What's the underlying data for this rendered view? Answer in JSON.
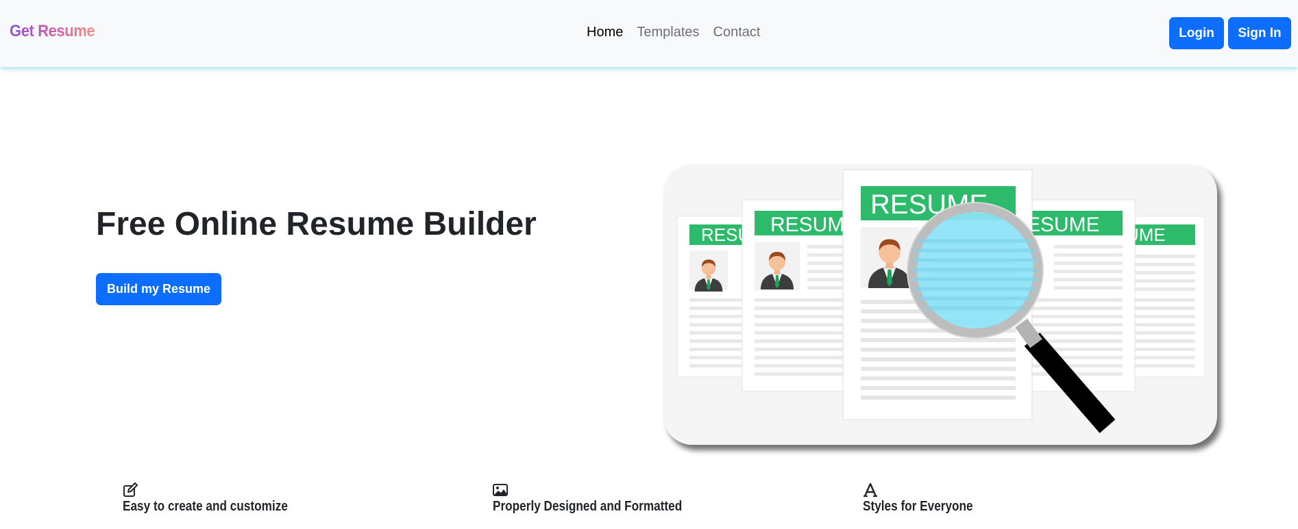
{
  "brand": {
    "name": "Get Resume"
  },
  "nav": {
    "links": [
      {
        "label": "Home",
        "active": true
      },
      {
        "label": "Templates",
        "active": false
      },
      {
        "label": "Contact",
        "active": false
      }
    ]
  },
  "auth": {
    "login_label": "Login",
    "signin_label": "Sign In"
  },
  "hero": {
    "title": "Free Online Resume Builder",
    "cta_label": "Build my Resume",
    "image": {
      "resume_header_text": "RESUME"
    }
  },
  "features": [
    {
      "icon": "pencil-square-icon",
      "title": "Easy to create and customize"
    },
    {
      "icon": "image-icon",
      "title": "Properly Designed and Formatted"
    },
    {
      "icon": "font-icon",
      "title": "Styles for Everyone"
    }
  ],
  "colors": {
    "primary": "#0d6efd",
    "navbar_bg": "#f8f9fa",
    "resume_green": "#2dba6a",
    "lens_blue": "#8be3f7"
  }
}
